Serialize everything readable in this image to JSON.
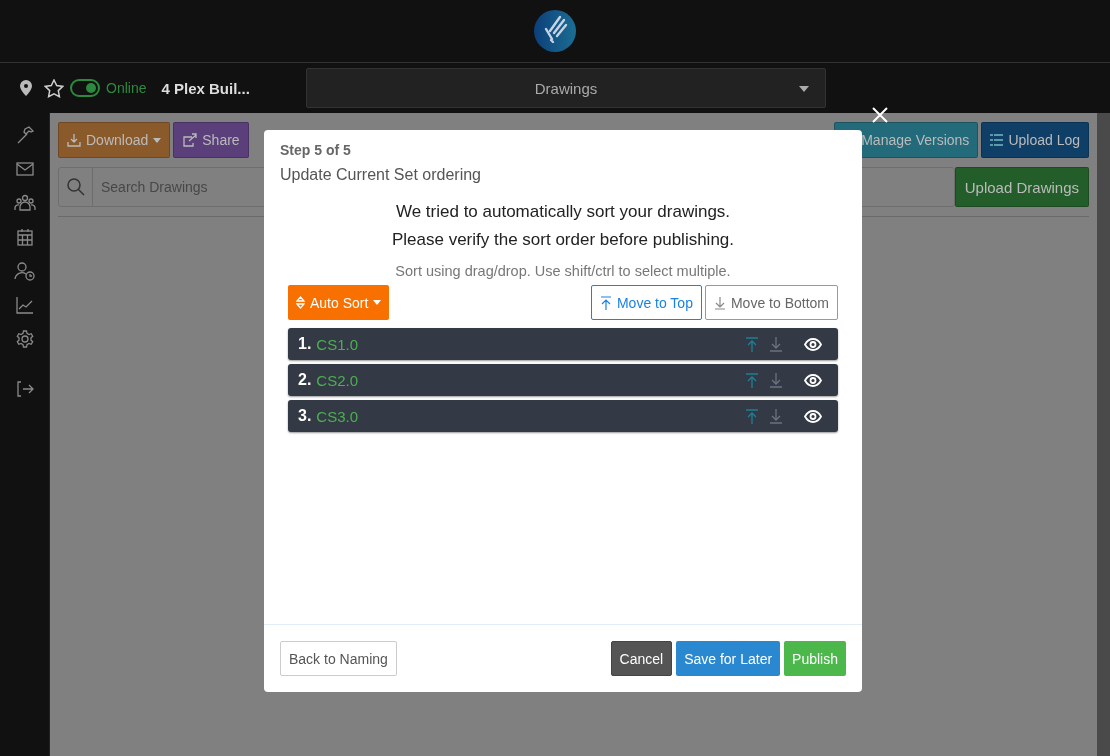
{
  "topbar": {
    "online": {
      "on": true,
      "label": "Online"
    },
    "project": "4 Plex Buil...",
    "view_select": "Drawings"
  },
  "toolbar": {
    "download": "Download",
    "share": "Share",
    "manage_versions": "Manage Versions",
    "upload_log": "Upload Log"
  },
  "search": {
    "placeholder": "Search Drawings"
  },
  "upload_button": "Upload Drawings",
  "modal": {
    "step": "Step 5 of 5",
    "title": "Update Current Set ordering",
    "message": [
      "We tried to automatically sort your drawings.",
      "Please verify the sort order before publishing."
    ],
    "hint": "Sort using drag/drop. Use shift/ctrl to select multiple.",
    "auto_sort": "Auto Sort",
    "move_buttons": [
      {
        "kind": "top",
        "label": "Move to Top",
        "focused": true
      },
      {
        "kind": "bottom",
        "label": "Move to Bottom",
        "focused": false
      }
    ],
    "items": [
      {
        "number": "1.",
        "name": "CS1.0"
      },
      {
        "number": "2.",
        "name": "CS2.0"
      },
      {
        "number": "3.",
        "name": "CS3.0"
      }
    ],
    "footer": {
      "back": "Back to Naming",
      "cancel": "Cancel",
      "save": "Save for Later",
      "publish": "Publish"
    }
  }
}
